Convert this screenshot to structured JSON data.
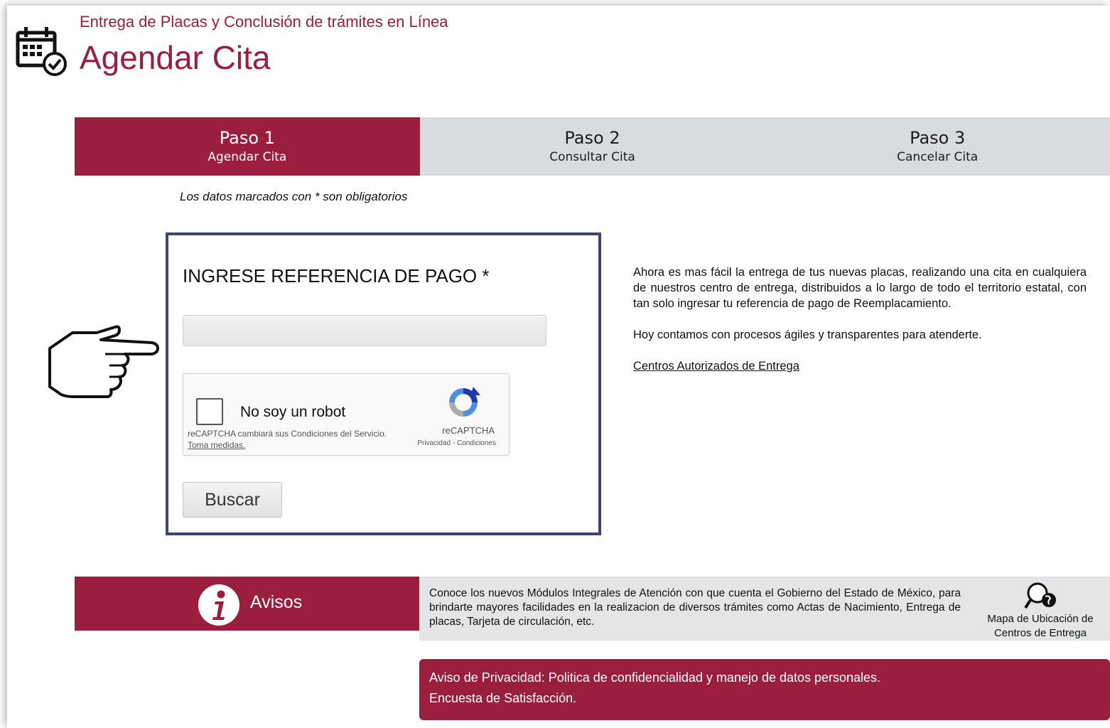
{
  "header": {
    "subtitle": "Entrega de Placas y Conclusión de trámites en Línea",
    "title": "Agendar Cita",
    "icon": "calendar-check-icon"
  },
  "steps": [
    {
      "num": "Paso 1",
      "label": "Agendar Cita",
      "active": true
    },
    {
      "num": "Paso 2",
      "label": "Consultar Cita",
      "active": false
    },
    {
      "num": "Paso 3",
      "label": "Cancelar Cita",
      "active": false
    }
  ],
  "required_note": "Los datos marcados con * son obligatorios",
  "form": {
    "label": "INGRESE REFERENCIA DE PAGO *",
    "input_value": "",
    "button": "Buscar"
  },
  "captcha": {
    "label": "No soy un robot",
    "note": "reCAPTCHA cambiará sus Condiciones del Servicio.",
    "note_link": "Toma medidas.",
    "brand": "reCAPTCHA",
    "links": "Privacidad - Condiciones"
  },
  "info": {
    "p1": "Ahora es mas fácil la entrega de tus nuevas placas, realizando una cita en cualquiera de nuestros centro de entrega, distribuidos a lo largo de todo el territorio estatal, con tan solo ingresar tu referencia de pago de Reemplacamiento.",
    "p2": "Hoy contamos con procesos ágiles y transparentes para atenderte.",
    "link": "Centros Autorizados de Entrega"
  },
  "avisos": {
    "label": "Avisos",
    "text": "Conoce los nuevos Módulos Integrales de Atención con que cuenta el Gobierno del Estado de México, para brindarte mayores facilidades en la realizacion de diversos trámites como Actas de Nacimiento, Entrega de placas, Tarjeta de circulación, etc.",
    "map_label": "Mapa de Ubicación de Centros de Entrega"
  },
  "privacy": {
    "line1": "Aviso de Privacidad: Politica de confidencialidad y manejo de datos personales.",
    "line2": "Encuesta de Satisfacción."
  },
  "colors": {
    "brand": "#9c1e3e",
    "step_inactive": "#d9dcdf",
    "form_border": "#3f4470"
  }
}
